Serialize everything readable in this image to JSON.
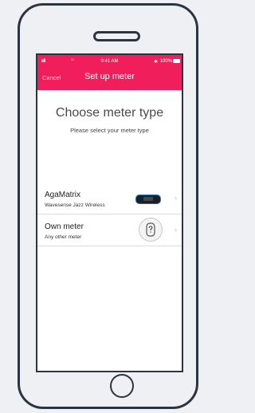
{
  "status": {
    "signal": "ııll",
    "wifi": "≈",
    "time": "9:41 AM",
    "bluetooth": "✱",
    "battery": "100%"
  },
  "nav": {
    "cancel_label": "Cancel",
    "title": "Set up meter"
  },
  "main": {
    "heading": "Choose meter type",
    "subheading": "Please select your meter type"
  },
  "meters": [
    {
      "title": "AgaMatrix",
      "subtitle": "Wavesense Jazz Wireless",
      "icon": "glucose-meter-image"
    },
    {
      "title": "Own meter",
      "subtitle": "Any other meter",
      "icon": "unknown-meter-icon"
    }
  ],
  "chevron": "›",
  "colors": {
    "accent": "#f01f5b",
    "frame": "#2b3440",
    "background": "#eef0f3"
  }
}
